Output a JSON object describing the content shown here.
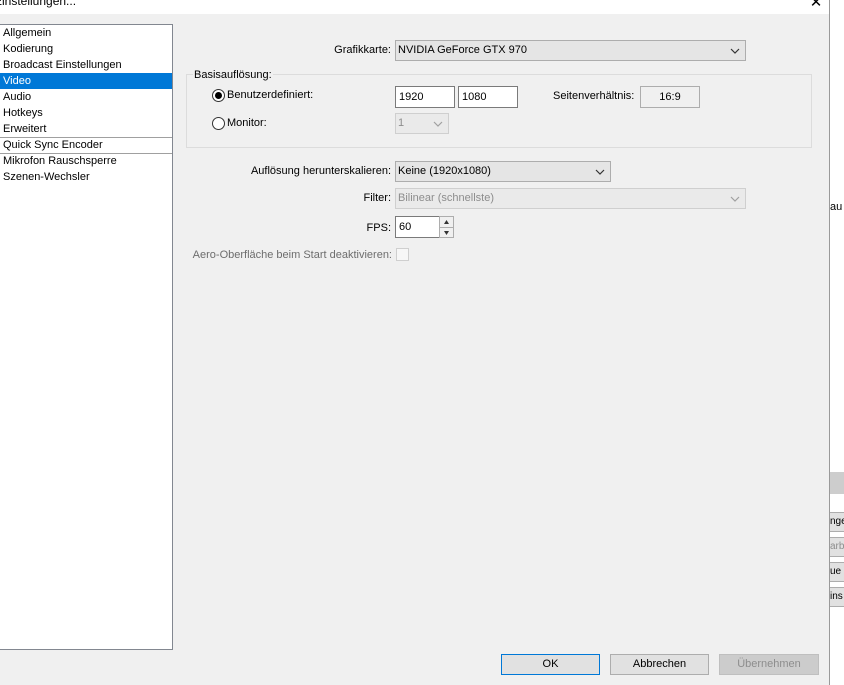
{
  "window": {
    "title": "Einstellungen...",
    "close_symbol": "✕"
  },
  "categories": [
    {
      "label": "Allgemein"
    },
    {
      "label": "Kodierung"
    },
    {
      "label": "Broadcast Einstellungen"
    },
    {
      "label": "Video"
    },
    {
      "label": "Audio"
    },
    {
      "label": "Hotkeys"
    },
    {
      "label": "Erweitert"
    },
    {
      "label": "Quick Sync Encoder"
    },
    {
      "label": "Mikrofon Rauschsperre"
    },
    {
      "label": "Szenen-Wechsler"
    }
  ],
  "selected_category": "Video",
  "video": {
    "grafikkarte_label": "Grafikkarte:",
    "grafikkarte_value": "NVIDIA GeForce GTX 970",
    "basisaufloesung_label": "Basisauflösung:",
    "benutzerdefiniert_label": "Benutzerdefiniert:",
    "width_value": "1920",
    "height_value": "1080",
    "seitenverhaeltnis_label": "Seitenverhältnis:",
    "seitenverhaeltnis_value": "16:9",
    "monitor_label": "Monitor:",
    "monitor_value": "1",
    "herunterskalieren_label": "Auflösung herunterskalieren:",
    "herunterskalieren_value": "Keine  (1920x1080)",
    "filter_label": "Filter:",
    "filter_value": "Bilinear (schnellste)",
    "fps_label": "FPS:",
    "fps_value": "60",
    "aero_label": "Aero-Oberfläche beim Start deaktivieren:"
  },
  "buttons": {
    "ok": "OK",
    "abbrechen": "Abbrechen",
    "uebernehmen": "Übernehmen"
  },
  "background_fragments": [
    "au",
    "nge",
    "arb",
    "ue",
    "ins"
  ]
}
